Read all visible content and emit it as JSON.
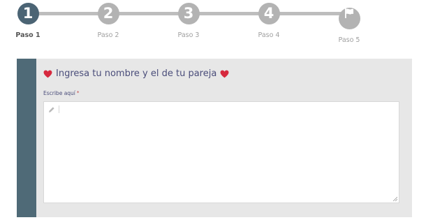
{
  "progress": {
    "steps": [
      {
        "label": "Paso 1",
        "number": "1",
        "active": true
      },
      {
        "label": "Paso 2",
        "number": "2",
        "active": false
      },
      {
        "label": "Paso 3",
        "number": "3",
        "active": false
      },
      {
        "label": "Paso 4",
        "number": "4",
        "active": false
      },
      {
        "label": "Paso 5",
        "icon": "flag-icon",
        "active": false
      }
    ]
  },
  "form": {
    "title": "Ingresa tu nombre y el de tu pareja",
    "field_label": "Escribe aquí",
    "required_mark": "*",
    "field_value": "",
    "heart_color": "#d6293e",
    "accent_color": "#4f6a77"
  }
}
